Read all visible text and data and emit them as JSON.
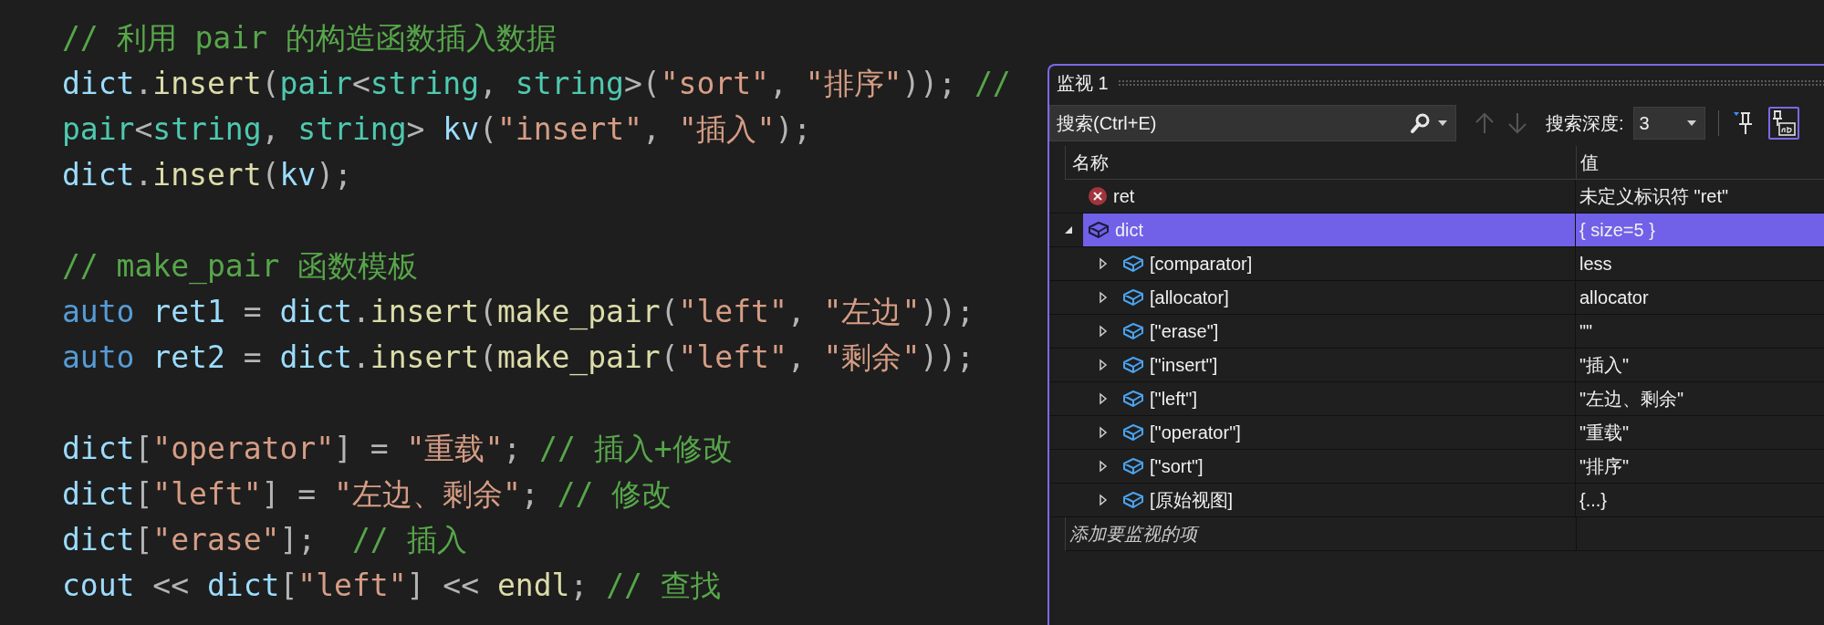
{
  "editor": {
    "blocks": [
      [
        [
          {
            "kind": "comment",
            "text": "// 利用 pair 的构造函数插入数据"
          }
        ],
        [
          {
            "kind": "var",
            "text": "dict"
          },
          {
            "kind": "punct",
            "text": "."
          },
          {
            "kind": "func",
            "text": "insert"
          },
          {
            "kind": "punct",
            "text": "("
          },
          {
            "kind": "type",
            "text": "pair"
          },
          {
            "kind": "punct",
            "text": "<"
          },
          {
            "kind": "type",
            "text": "string"
          },
          {
            "kind": "punct",
            "text": ", "
          },
          {
            "kind": "type",
            "text": "string"
          },
          {
            "kind": "punct",
            "text": ">("
          },
          {
            "kind": "string",
            "text": "\"sort\""
          },
          {
            "kind": "punct",
            "text": ", "
          },
          {
            "kind": "string",
            "text": "\"排序\""
          },
          {
            "kind": "punct",
            "text": ")); "
          },
          {
            "kind": "comment",
            "text": "//"
          }
        ],
        [
          {
            "kind": "type",
            "text": "pair"
          },
          {
            "kind": "punct",
            "text": "<"
          },
          {
            "kind": "type",
            "text": "string"
          },
          {
            "kind": "punct",
            "text": ", "
          },
          {
            "kind": "type",
            "text": "string"
          },
          {
            "kind": "punct",
            "text": "> "
          },
          {
            "kind": "var",
            "text": "kv"
          },
          {
            "kind": "punct",
            "text": "("
          },
          {
            "kind": "string",
            "text": "\"insert\""
          },
          {
            "kind": "punct",
            "text": ", "
          },
          {
            "kind": "string",
            "text": "\"插入\""
          },
          {
            "kind": "punct",
            "text": ");"
          }
        ],
        [
          {
            "kind": "var",
            "text": "dict"
          },
          {
            "kind": "punct",
            "text": "."
          },
          {
            "kind": "func",
            "text": "insert"
          },
          {
            "kind": "punct",
            "text": "("
          },
          {
            "kind": "var",
            "text": "kv"
          },
          {
            "kind": "punct",
            "text": ");"
          }
        ]
      ],
      [
        [
          {
            "kind": "comment",
            "text": "// make_pair 函数模板"
          }
        ],
        [
          {
            "kind": "keyword",
            "text": "auto "
          },
          {
            "kind": "var",
            "text": "ret1"
          },
          {
            "kind": "punct",
            "text": " = "
          },
          {
            "kind": "var",
            "text": "dict"
          },
          {
            "kind": "punct",
            "text": "."
          },
          {
            "kind": "func",
            "text": "insert"
          },
          {
            "kind": "punct",
            "text": "("
          },
          {
            "kind": "func",
            "text": "make_pair"
          },
          {
            "kind": "punct",
            "text": "("
          },
          {
            "kind": "string",
            "text": "\"left\""
          },
          {
            "kind": "punct",
            "text": ", "
          },
          {
            "kind": "string",
            "text": "\"左边\""
          },
          {
            "kind": "punct",
            "text": "));"
          }
        ],
        [
          {
            "kind": "keyword",
            "text": "auto "
          },
          {
            "kind": "var",
            "text": "ret2"
          },
          {
            "kind": "punct",
            "text": " = "
          },
          {
            "kind": "var",
            "text": "dict"
          },
          {
            "kind": "punct",
            "text": "."
          },
          {
            "kind": "func",
            "text": "insert"
          },
          {
            "kind": "punct",
            "text": "("
          },
          {
            "kind": "func",
            "text": "make_pair"
          },
          {
            "kind": "punct",
            "text": "("
          },
          {
            "kind": "string",
            "text": "\"left\""
          },
          {
            "kind": "punct",
            "text": ", "
          },
          {
            "kind": "string",
            "text": "\"剩余\""
          },
          {
            "kind": "punct",
            "text": "));"
          }
        ]
      ],
      [
        [
          {
            "kind": "var",
            "text": "dict"
          },
          {
            "kind": "punct",
            "text": "["
          },
          {
            "kind": "string",
            "text": "\"operator\""
          },
          {
            "kind": "punct",
            "text": "] = "
          },
          {
            "kind": "string",
            "text": "\"重载\""
          },
          {
            "kind": "punct",
            "text": "; "
          },
          {
            "kind": "comment",
            "text": "// 插入+修改"
          }
        ],
        [
          {
            "kind": "var",
            "text": "dict"
          },
          {
            "kind": "punct",
            "text": "["
          },
          {
            "kind": "string",
            "text": "\"left\""
          },
          {
            "kind": "punct",
            "text": "] = "
          },
          {
            "kind": "string",
            "text": "\"左边、剩余\""
          },
          {
            "kind": "punct",
            "text": "; "
          },
          {
            "kind": "comment",
            "text": "// 修改"
          }
        ],
        [
          {
            "kind": "var",
            "text": "dict"
          },
          {
            "kind": "punct",
            "text": "["
          },
          {
            "kind": "string",
            "text": "\"erase\""
          },
          {
            "kind": "punct",
            "text": "];  "
          },
          {
            "kind": "comment",
            "text": "// 插入"
          }
        ],
        [
          {
            "kind": "var",
            "text": "cout"
          },
          {
            "kind": "punct",
            "text": " << "
          },
          {
            "kind": "var",
            "text": "dict"
          },
          {
            "kind": "punct",
            "text": "["
          },
          {
            "kind": "string",
            "text": "\"left\""
          },
          {
            "kind": "punct",
            "text": "] << "
          },
          {
            "kind": "func",
            "text": "endl"
          },
          {
            "kind": "punct",
            "text": "; "
          },
          {
            "kind": "comment",
            "text": "// 查找"
          }
        ]
      ]
    ]
  },
  "watch": {
    "title": "监视 1",
    "search": {
      "placeholder": "搜索(Ctrl+E)"
    },
    "nav_buttons": [
      {
        "kind": "up",
        "disabled": true
      },
      {
        "kind": "down",
        "disabled": true
      }
    ],
    "depth_label": "搜索深度:",
    "depth": {
      "value": "3"
    },
    "view_buttons": [
      {
        "selected": false
      },
      {
        "selected": true
      }
    ],
    "columns": [
      "名称",
      "值"
    ],
    "rows": [
      {
        "kind": "error",
        "name": "ret",
        "value": "未定义标识符 \"ret\"",
        "selected": false
      },
      {
        "kind": "object",
        "name": "dict",
        "value": "{ size=5 }",
        "selected": true,
        "expanded": true,
        "children": [
          {
            "kind": "object",
            "name": "[comparator]",
            "value": "less",
            "selected": false,
            "expanded": false
          },
          {
            "kind": "object",
            "name": "[allocator]",
            "value": "allocator",
            "selected": false,
            "expanded": false
          },
          {
            "kind": "object",
            "name": "[\"erase\"]",
            "value": "\"\"",
            "selected": false,
            "expanded": false
          },
          {
            "kind": "object",
            "name": "[\"insert\"]",
            "value": "\"插入\"",
            "selected": false,
            "expanded": false
          },
          {
            "kind": "object",
            "name": "[\"left\"]",
            "value": "\"左边、剩余\"",
            "selected": false,
            "expanded": false
          },
          {
            "kind": "object",
            "name": "[\"operator\"]",
            "value": "\"重载\"",
            "selected": false,
            "expanded": false
          },
          {
            "kind": "object",
            "name": "[\"sort\"]",
            "value": "\"排序\"",
            "selected": false,
            "expanded": false
          },
          {
            "kind": "object",
            "name": "[原始视图]",
            "value": "{...}",
            "selected": false,
            "expanded": false
          }
        ]
      }
    ],
    "add_row": {
      "placeholder": "添加要监视的项"
    }
  }
}
